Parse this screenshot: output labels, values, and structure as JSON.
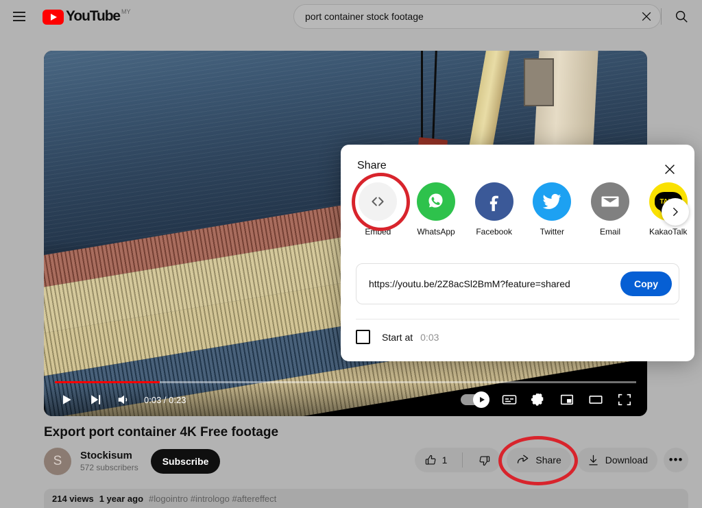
{
  "header": {
    "menu_icon": "hamburger-menu-icon",
    "logo_text": "YouTube",
    "logo_country": "MY",
    "search": {
      "value": "port container stock footage",
      "placeholder": "Search",
      "clear_icon": "close-icon",
      "search_icon": "search-icon"
    }
  },
  "player": {
    "current_time": "0:03",
    "duration": "0:23",
    "time_display": "0:03 / 0:23",
    "progress_percent": 18,
    "controls": {
      "play": "play-icon",
      "next": "next-video-icon",
      "volume": "volume-icon",
      "autoplay": "autoplay-toggle",
      "subtitles": "subtitles-icon",
      "settings": "gear-icon",
      "miniplayer": "miniplayer-icon",
      "theater": "theater-mode-icon",
      "fullscreen": "fullscreen-icon"
    }
  },
  "share_dialog": {
    "title": "Share",
    "close_icon": "close-icon",
    "targets": [
      {
        "label": "Embed",
        "icon": "code-icon",
        "color": "#f2f2f2"
      },
      {
        "label": "WhatsApp",
        "icon": "whatsapp-icon",
        "color": "#2ec24c"
      },
      {
        "label": "Facebook",
        "icon": "facebook-icon",
        "color": "#3b5998"
      },
      {
        "label": "Twitter",
        "icon": "twitter-icon",
        "color": "#1da1f2"
      },
      {
        "label": "Email",
        "icon": "email-icon",
        "color": "#808080"
      },
      {
        "label": "KakaoTalk",
        "icon": "kakaotalk-icon",
        "color": "#fae100"
      }
    ],
    "kakao_text": "TALK",
    "next_icon": "chevron-right-icon",
    "url": "https://youtu.be/2Z8acSl2BmM?feature=shared",
    "copy_label": "Copy",
    "start_at_label": "Start at",
    "start_at_time": "0:03",
    "start_at_checked": false
  },
  "video": {
    "title": "Export port container 4K Free footage",
    "channel": {
      "avatar_letter": "S",
      "name": "Stockisum",
      "subscribers": "572 subscribers",
      "subscribe_label": "Subscribe"
    },
    "actions": {
      "like_count": "1",
      "like_icon": "thumbs-up-icon",
      "dislike_icon": "thumbs-down-icon",
      "share_label": "Share",
      "share_icon": "share-arrow-icon",
      "download_label": "Download",
      "download_icon": "download-icon",
      "more_label": "•••"
    },
    "meta": {
      "views": "214 views",
      "published": "1 year ago",
      "hashtags": "#logointro #intrologo #aftereffect"
    }
  },
  "annotations": {
    "color": "#d8242c",
    "highlighted": [
      "embed-button",
      "share-button"
    ]
  }
}
